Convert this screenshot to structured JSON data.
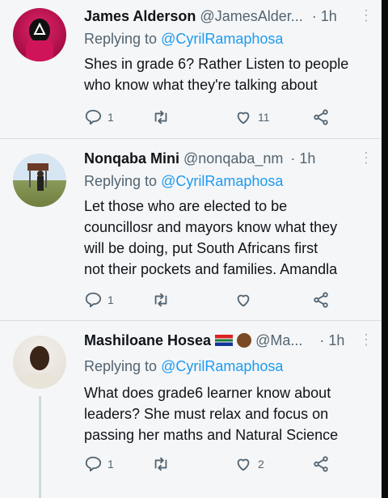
{
  "tweets": [
    {
      "name": "James Alderson",
      "handle": "@JamesAlder...",
      "time": "· 1h",
      "replying_prefix": "Replying to ",
      "replying_handle": "@CyrilRamaphosa",
      "lines": [
        "Shes in grade 6? Rather Listen to people",
        "who know what they're talking about"
      ],
      "replies": "1",
      "retweets": "",
      "likes": "11"
    },
    {
      "name": "Nonqaba Mini",
      "handle": "@nonqaba_nm",
      "time": "· 1h",
      "replying_prefix": "Replying to ",
      "replying_handle": "@CyrilRamaphosa",
      "lines": [
        "Let those who are elected to be",
        "councillosr and mayors know what they",
        "will  be doing, put South Africans first",
        "not their pockets and families. Amandla"
      ],
      "replies": "1",
      "retweets": "",
      "likes": ""
    },
    {
      "name": "Mashiloane Hosea",
      "handle": "@Ma...",
      "time": "· 1h",
      "replying_prefix": "Replying to ",
      "replying_handle": "@CyrilRamaphosa",
      "lines": [
        "What does grade6 learner know about",
        "leaders? She must relax and focus on",
        "passing her maths and Natural Science"
      ],
      "replies": "1",
      "retweets": "",
      "likes": "2"
    }
  ],
  "colors": {
    "link": "#1d9bf0",
    "text": "#0f1419",
    "muted": "#536471"
  },
  "icons": [
    "reply-icon",
    "retweet-icon",
    "like-icon",
    "share-icon",
    "more-icon"
  ]
}
